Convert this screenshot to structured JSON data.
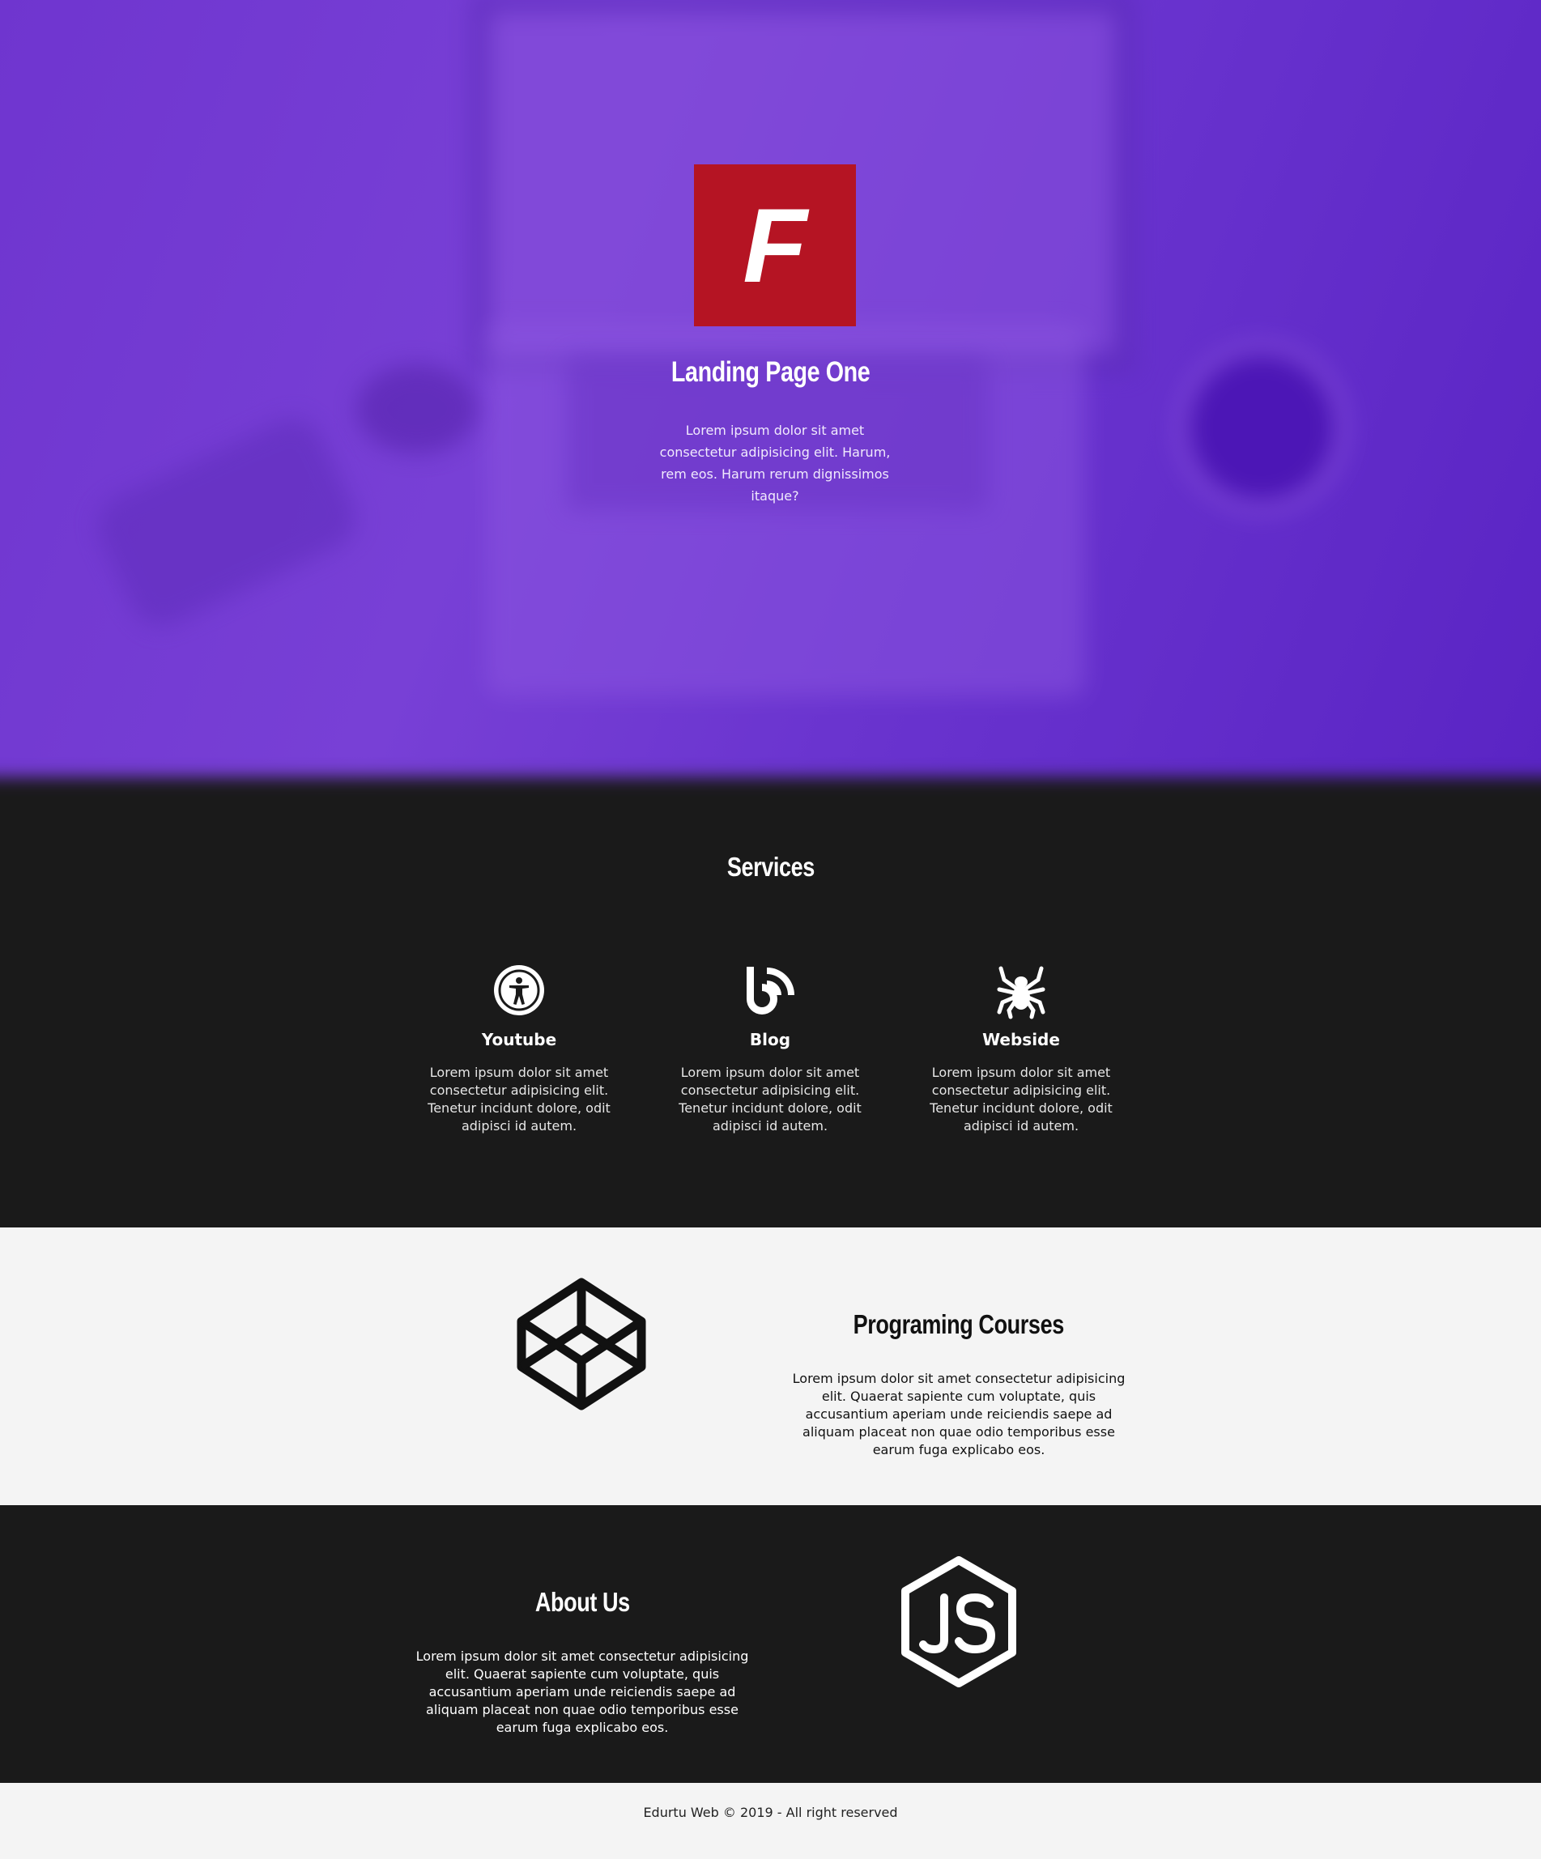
{
  "hero": {
    "logo_letter": "F",
    "title": "Landing Page One",
    "description": "Lorem ipsum dolor sit amet consectetur adipisicing elit. Harum, rem eos. Harum rerum dignissimos itaque?",
    "logo_color": "#b51423",
    "overlay_color": "#6f35cf"
  },
  "services": {
    "title": "Services",
    "items": [
      {
        "icon": "accessibility-icon",
        "name": "Youtube",
        "text": "Lorem ipsum dolor sit amet consectetur adipisicing elit. Tenetur incidunt dolore, odit adipisci id autem."
      },
      {
        "icon": "blog-rss-icon",
        "name": "Blog",
        "text": "Lorem ipsum dolor sit amet consectetur adipisicing elit. Tenetur incidunt dolore, odit adipisci id autem."
      },
      {
        "icon": "spider-icon",
        "name": "Webside",
        "text": "Lorem ipsum dolor sit amet consectetur adipisicing elit. Tenetur incidunt dolore, odit adipisci id autem."
      }
    ]
  },
  "courses": {
    "icon": "codepen-icon",
    "title": "Programing Courses",
    "text": "Lorem ipsum dolor sit amet consectetur adipisicing elit. Quaerat sapiente cum voluptate, quis accusantium aperiam unde reiciendis saepe ad aliquam placeat non quae odio temporibus esse earum fuga explicabo eos."
  },
  "about": {
    "icon": "nodejs-icon",
    "title": "About Us",
    "text": "Lorem ipsum dolor sit amet consectetur adipisicing elit. Quaerat sapiente cum voluptate, quis accusantium aperiam unde reiciendis saepe ad aliquam placeat non quae odio temporibus esse earum fuga explicabo eos."
  },
  "footer": {
    "text": "Edurtu Web © 2019 - All right reserved"
  },
  "colors": {
    "dark_section": "#1a1a1a",
    "light_section": "#f4f4f4"
  }
}
